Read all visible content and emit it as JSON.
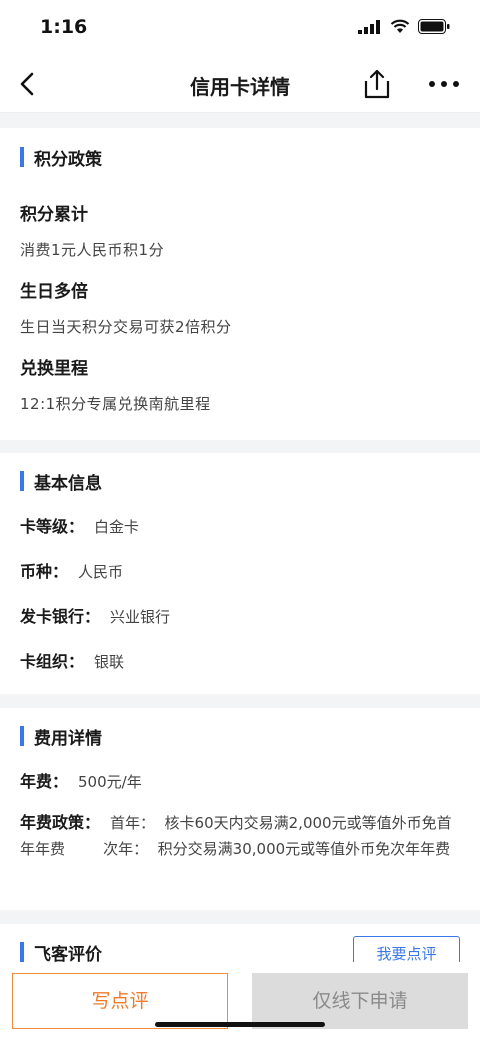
{
  "status": {
    "time": "1:16"
  },
  "nav": {
    "title": "信用卡详情"
  },
  "points_policy": {
    "section_title": "积分政策",
    "items": [
      {
        "title": "积分累计",
        "desc": "消费1元人民币积1分"
      },
      {
        "title": "生日多倍",
        "desc": "生日当天积分交易可获2倍积分"
      },
      {
        "title": "兑换里程",
        "desc": "12:1积分专属兑换南航里程"
      }
    ]
  },
  "basic_info": {
    "section_title": "基本信息",
    "rows": [
      {
        "label": "卡等级：",
        "value": "白金卡"
      },
      {
        "label": "币种：",
        "value": "人民币"
      },
      {
        "label": "发卡银行：",
        "value": "兴业银行"
      },
      {
        "label": "卡组织：",
        "value": "银联"
      }
    ]
  },
  "fees": {
    "section_title": "费用详情",
    "annual_fee_label": "年费：",
    "annual_fee_value": "500元/年",
    "policy_label": "年费政策：",
    "policy_text": "首年：  核卡60天内交易满2,000元或等值外币免首年年费        次年：  积分交易满30,000元或等值外币免次年年费"
  },
  "reviews": {
    "section_title": "飞客评价",
    "review_button": "我要点评"
  },
  "bottom": {
    "write_review": "写点评",
    "apply_offline": "仅线下申请"
  },
  "colors": {
    "accent_blue": "#3b78e7",
    "accent_orange": "#f07a28",
    "disabled_gray": "#dcdcdc"
  }
}
